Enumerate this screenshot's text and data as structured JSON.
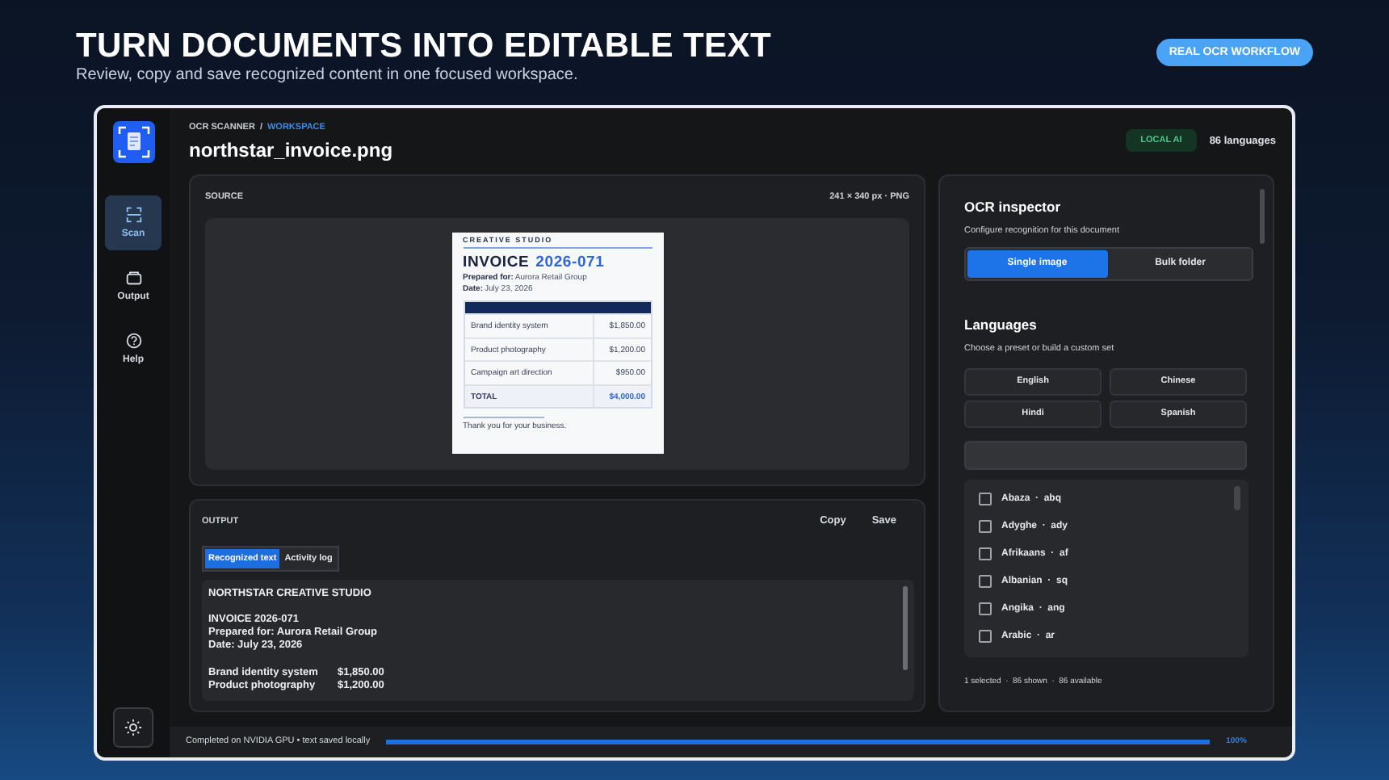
{
  "hero": {
    "title": "TURN DOCUMENTS INTO EDITABLE TEXT",
    "subtitle": "Review, copy and save recognized content in one focused workspace.",
    "badge": "REAL OCR WORKFLOW"
  },
  "sidebar": {
    "items": [
      {
        "label": "Scan",
        "selected": true
      },
      {
        "label": "Output",
        "selected": false
      },
      {
        "label": "Help",
        "selected": false
      }
    ]
  },
  "breadcrumb": {
    "root": "OCR SCANNER",
    "separator": "/",
    "current": "WORKSPACE"
  },
  "file_title": "northstar_invoice.png",
  "badges": {
    "status": "LOCAL AI",
    "languages": "86 languages"
  },
  "source": {
    "label": "SOURCE",
    "meta": "241 × 340 px · PNG",
    "document": {
      "brand": "CREATIVE STUDIO",
      "title": "INVOICE",
      "number": "2026-071",
      "fields": [
        {
          "label": "Prepared for:",
          "value": "Aurora Retail Group"
        },
        {
          "label": "Date:",
          "value": "July 23, 2026"
        }
      ],
      "rows": [
        {
          "kind": "item",
          "description": "Brand identity system",
          "amount": "$1,850.00"
        },
        {
          "kind": "item",
          "description": "Product photography",
          "amount": "$1,200.00"
        },
        {
          "kind": "item",
          "description": "Campaign art direction",
          "amount": "$950.00"
        },
        {
          "kind": "total",
          "description": "TOTAL",
          "amount": "$4,000.00"
        }
      ],
      "footer": "Thank you for your business."
    }
  },
  "output": {
    "label": "OUTPUT",
    "actions": [
      "Copy",
      "Save"
    ],
    "tabs": [
      {
        "label": "Recognized text",
        "selected": true
      },
      {
        "label": "Activity log",
        "selected": false
      }
    ],
    "blocks": [
      {
        "kind": "lines",
        "lines": [
          "NORTHSTAR CREATIVE STUDIO"
        ]
      },
      {
        "kind": "lines",
        "lines": [
          "INVOICE 2026-071",
          "Prepared for: Aurora Retail Group",
          "Date: July 23, 2026"
        ]
      },
      {
        "kind": "table",
        "rows": [
          {
            "label": "Brand identity system",
            "amount": "$1,850.00"
          },
          {
            "label": "Product photography",
            "amount": "$1,200.00"
          }
        ]
      }
    ]
  },
  "inspector": {
    "title": "OCR inspector",
    "subtitle": "Configure recognition for this document",
    "modes": [
      {
        "label": "Single image",
        "selected": true
      },
      {
        "label": "Bulk folder",
        "selected": false
      }
    ],
    "languages_title": "Languages",
    "languages_subtitle": "Choose a preset or build a custom set",
    "presets": [
      "English",
      "Chinese",
      "Hindi",
      "Spanish"
    ],
    "languages": [
      {
        "label": "Abaza  ·  abq",
        "checked": false
      },
      {
        "label": "Adyghe  ·  ady",
        "checked": false
      },
      {
        "label": "Afrikaans  ·  af",
        "checked": false
      },
      {
        "label": "Albanian  ·  sq",
        "checked": false
      },
      {
        "label": "Angika  ·  ang",
        "checked": false
      },
      {
        "label": "Arabic  ·  ar",
        "checked": false
      }
    ],
    "footer": "1 selected  ·  86 shown  ·  86 available"
  },
  "status_bar": {
    "text": "Completed on NVIDIA GPU • text saved locally",
    "level": 1,
    "reading": "100%"
  }
}
